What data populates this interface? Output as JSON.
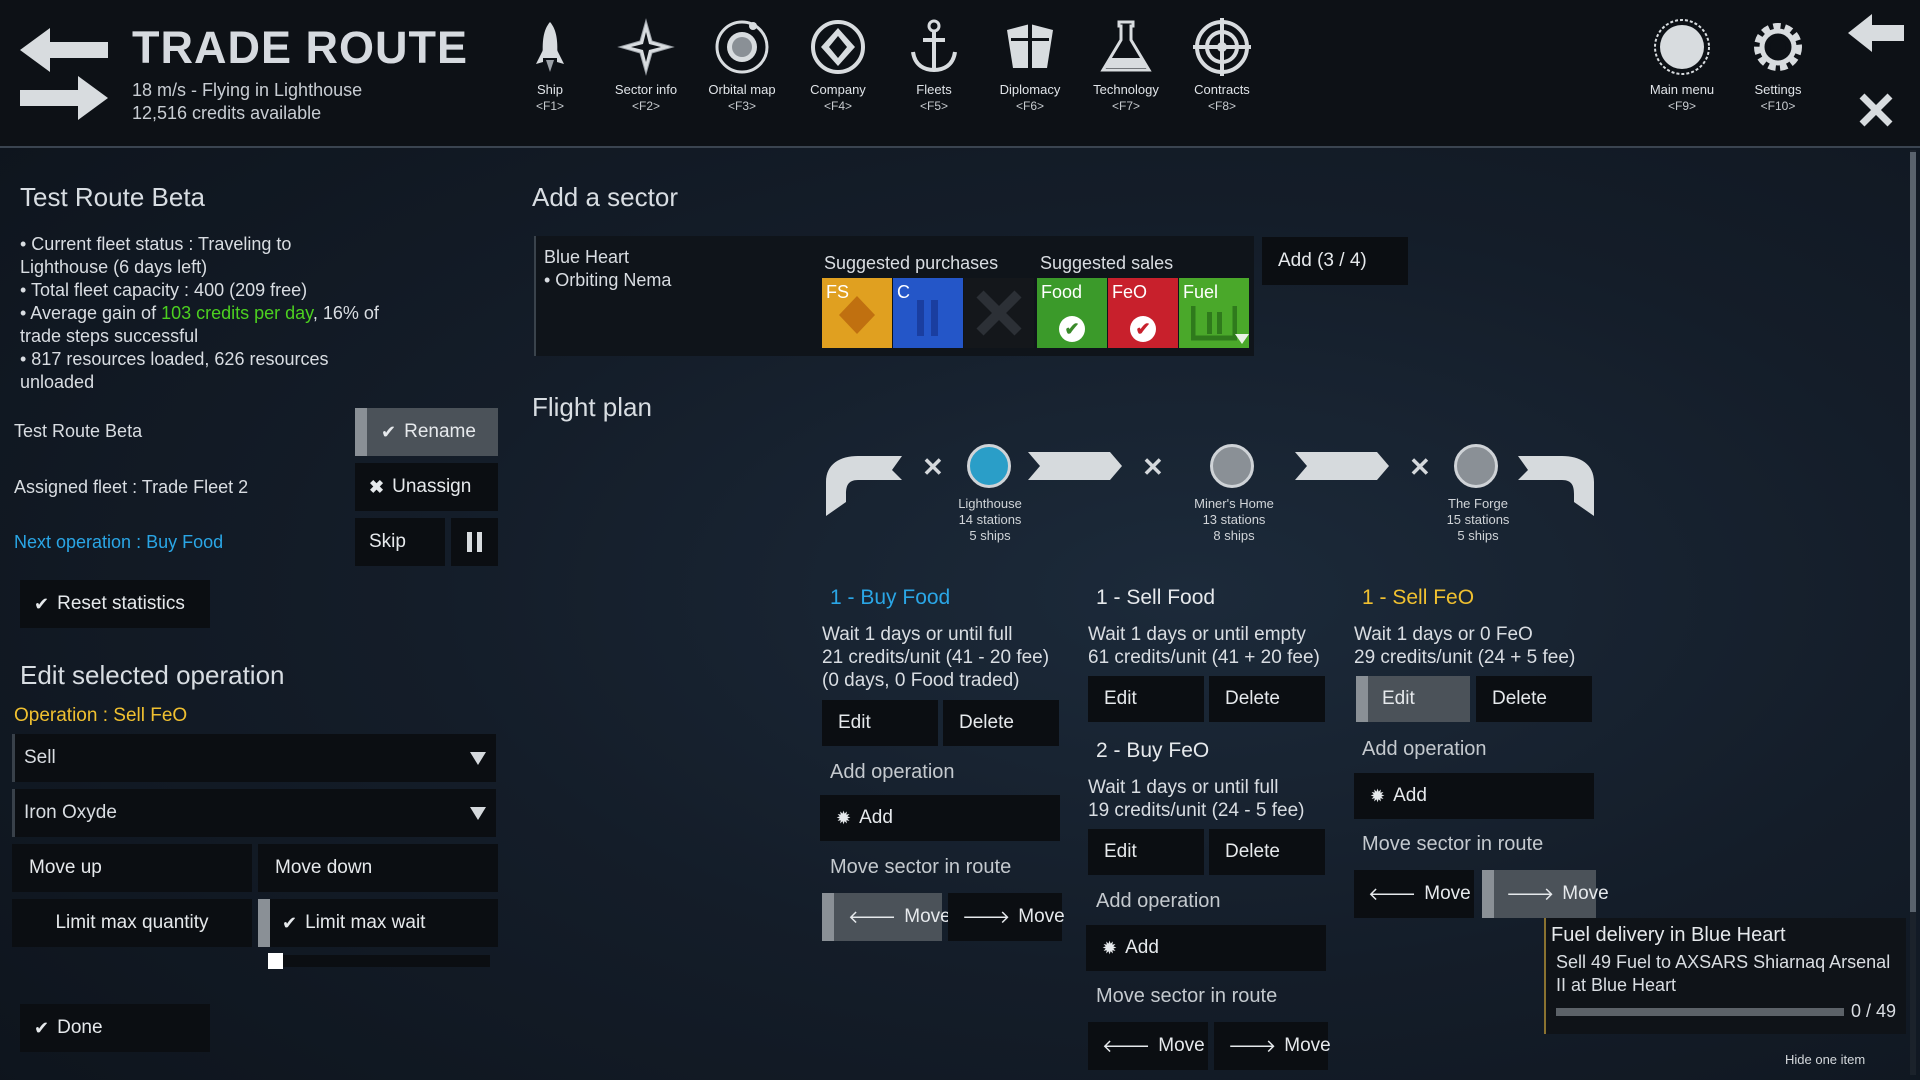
{
  "header": {
    "title": "TRADE ROUTE",
    "status_line": "18 m/s - Flying in Lighthouse",
    "credits_line": "12,516 credits available",
    "nav": [
      {
        "label": "Ship",
        "key": "<F1>",
        "icon": "rocket-icon"
      },
      {
        "label": "Sector info",
        "key": "<F2>",
        "icon": "compass-star-icon"
      },
      {
        "label": "Orbital map",
        "key": "<F3>",
        "icon": "orbit-icon"
      },
      {
        "label": "Company",
        "key": "<F4>",
        "icon": "company-emblem-icon"
      },
      {
        "label": "Fleets",
        "key": "<F5>",
        "icon": "anchor-icon"
      },
      {
        "label": "Diplomacy",
        "key": "<F6>",
        "icon": "shield-icon"
      },
      {
        "label": "Technology",
        "key": "<F7>",
        "icon": "flask-icon"
      },
      {
        "label": "Contracts",
        "key": "<F8>",
        "icon": "target-icon"
      },
      {
        "label": "Main menu",
        "key": "<F9>",
        "icon": "planet-icon"
      },
      {
        "label": "Settings",
        "key": "<F10>",
        "icon": "gear-icon"
      }
    ]
  },
  "route": {
    "name": "Test Route Beta",
    "stats": [
      "• Current fleet status : Traveling to",
      "Lighthouse (6 days left)",
      "• Total fleet capacity : 400 (209 free)"
    ],
    "gain_prefix": "• Average gain of ",
    "gain_value": "103 credits per day",
    "gain_suffix": ", 16% of",
    "gain_line2": "trade steps successful",
    "resources_line1": "• 817 resources loaded, 626 resources",
    "resources_line2": "unloaded",
    "name_label": "Test Route Beta",
    "rename": "Rename",
    "assigned": "Assigned fleet : Trade Fleet 2",
    "unassign": "Unassign",
    "next_op": "Next operation : Buy Food",
    "skip": "Skip",
    "reset": "Reset statistics"
  },
  "edit": {
    "title": "Edit selected operation",
    "operation": "Operation : Sell FeO",
    "type_value": "Sell",
    "resource_value": "Iron Oxyde",
    "move_up": "Move up",
    "move_down": "Move down",
    "limit_qty": "Limit max quantity",
    "limit_wait": "Limit max wait",
    "done": "Done"
  },
  "add_sector": {
    "title": "Add a sector",
    "sector_name": "Blue Heart",
    "sector_orbit": "• Orbiting Nema",
    "purchases_label": "Suggested purchases",
    "sales_label": "Suggested sales",
    "purchases": [
      {
        "code": "FS",
        "color": "#e0a020"
      },
      {
        "code": "C",
        "color": "#2456c8"
      },
      {
        "code": "",
        "color": "#14171b"
      }
    ],
    "sales": [
      {
        "code": "Food",
        "color": "#3b9a2a"
      },
      {
        "code": "FeO",
        "color": "#c8202c"
      },
      {
        "code": "Fuel",
        "color": "#4aa82a"
      }
    ],
    "add": "Add (3 / 4)"
  },
  "flight_plan": {
    "title": "Flight plan",
    "sectors": [
      {
        "name": "Lighthouse",
        "stations": "14 stations",
        "ships": "5 ships",
        "color": "#2a9ec8"
      },
      {
        "name": "Miner's Home",
        "stations": "13 stations",
        "ships": "8 ships",
        "color": "#8a9096"
      },
      {
        "name": "The Forge",
        "stations": "15 stations",
        "ships": "5 ships",
        "color": "#8a9096"
      }
    ],
    "col1": {
      "op1_title": "1 - Buy Food",
      "op1_l1": "Wait 1 days or until full",
      "op1_l2": "21 credits/unit (41 - 20 fee)",
      "op1_l3": "(0 days, 0 Food traded)",
      "edit": "Edit",
      "delete": "Delete",
      "add_op": "Add operation",
      "add": "Add",
      "move_sector": "Move sector in route",
      "move": "Move"
    },
    "col2": {
      "op1_title": "1 - Sell Food",
      "op1_l1": "Wait 1 days or until empty",
      "op1_l2": "61 credits/unit (41 + 20 fee)",
      "op2_title": "2 - Buy FeO",
      "op2_l1": "Wait 1 days or until full",
      "op2_l2": "19 credits/unit (24 - 5 fee)",
      "edit": "Edit",
      "delete": "Delete",
      "add_op": "Add operation",
      "add": "Add",
      "move_sector": "Move sector in route",
      "move": "Move"
    },
    "col3": {
      "op1_title": "1 - Sell FeO",
      "op1_l1": "Wait 1 days or 0 FeO",
      "op1_l2": "29 credits/unit (24 + 5 fee)",
      "edit": "Edit",
      "delete": "Delete",
      "add_op": "Add operation",
      "add": "Add",
      "move_sector": "Move sector in route",
      "move": "Move"
    }
  },
  "notification": {
    "title": "Fuel delivery in Blue Heart",
    "line1": "Sell 49 Fuel to AXSARS Shiarnaq Arsenal",
    "line2": "II at Blue Heart",
    "progress_text": "0 / 49",
    "progress": 0,
    "hide": "Hide one item"
  },
  "colors": {
    "accent_blue": "#2aa6e6",
    "accent_yellow": "#f0c030",
    "green": "#4cd020"
  }
}
